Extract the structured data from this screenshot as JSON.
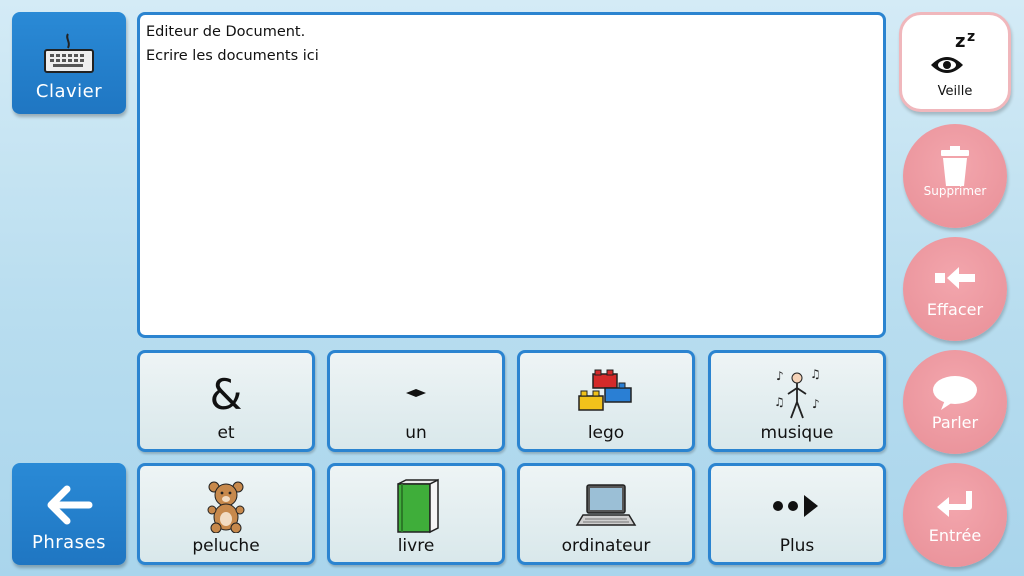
{
  "sidebar": {
    "keyboard_label": "Clavier",
    "phrases_label": "Phrases"
  },
  "editor": {
    "lines": [
      "Editeur de Document.",
      "Ecrire les documents ici"
    ]
  },
  "tiles": [
    {
      "label": "et",
      "icon": "ampersand-icon"
    },
    {
      "label": "un",
      "icon": "diamond-icon"
    },
    {
      "label": "lego",
      "icon": "lego-icon"
    },
    {
      "label": "musique",
      "icon": "music-icon"
    },
    {
      "label": "peluche",
      "icon": "teddy-bear-icon"
    },
    {
      "label": "livre",
      "icon": "book-icon"
    },
    {
      "label": "ordinateur",
      "icon": "laptop-icon"
    },
    {
      "label": "Plus",
      "icon": "more-arrow-icon"
    }
  ],
  "actions": {
    "sleep_label": "Veille",
    "delete_label": "Supprimer",
    "erase_label": "Effacer",
    "speak_label": "Parler",
    "enter_label": "Entrée"
  },
  "colors": {
    "blue_button": "#2a8ad6",
    "tile_border": "#2b84d0",
    "pink_button": "#e88f97"
  }
}
